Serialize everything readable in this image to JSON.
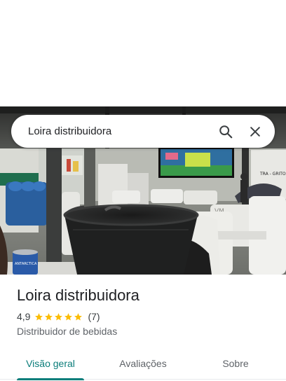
{
  "search": {
    "query": "Loira distribuidora"
  },
  "icons": {
    "search": "search-icon",
    "close": "close-icon",
    "star": "star-icon"
  },
  "place": {
    "name": "Loira distribuidora",
    "rating": "4,9",
    "rating_value": 4.9,
    "stars_max": 5,
    "review_count": "(7)",
    "category": "Distribuidor de bebidas"
  },
  "photo": {
    "wall_sign": "TRA - GRITO",
    "sign_mid": "VM",
    "can_text": "ANTARCTICA"
  },
  "tabs": [
    {
      "label": "Visão geral",
      "active": true
    },
    {
      "label": "Avaliações",
      "active": false
    },
    {
      "label": "Sobre",
      "active": false
    }
  ],
  "colors": {
    "accent": "#0b7d7a",
    "star": "#fbbc04",
    "text_primary": "#202124",
    "text_secondary": "#5f6368"
  }
}
